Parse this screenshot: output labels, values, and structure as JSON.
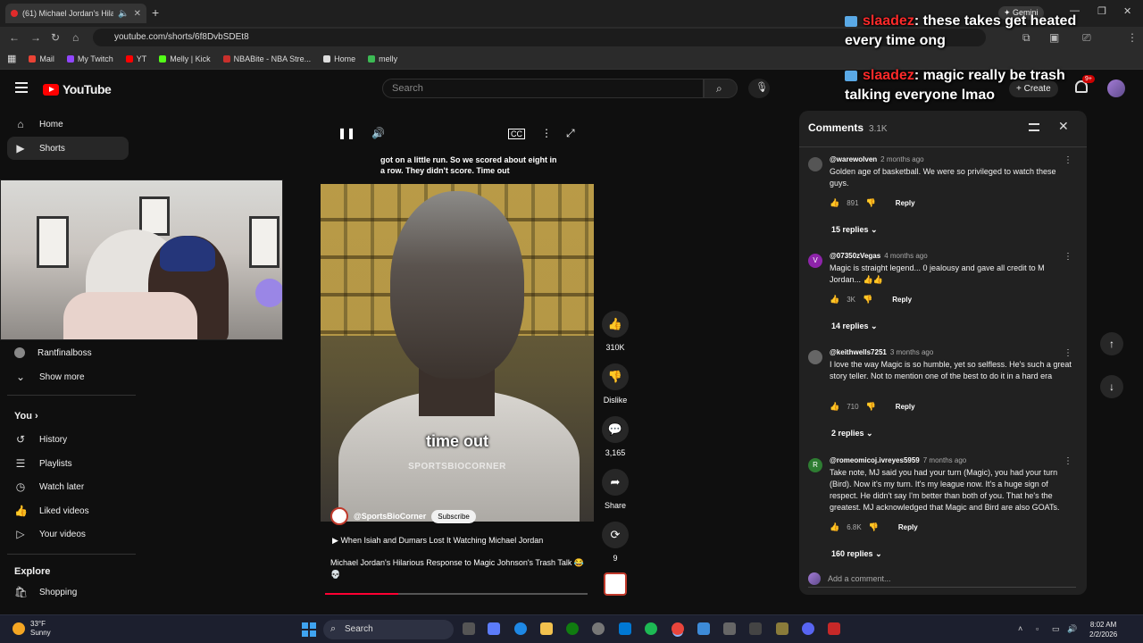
{
  "browser": {
    "tab_title": "(61) Michael Jordan's Hilari",
    "url": "youtube.com/shorts/6f8DvbSDEt8",
    "gemini_label": "Gemini",
    "bookmarks": [
      {
        "label": "Mail",
        "color": "#ea4335"
      },
      {
        "label": "My Twitch",
        "color": "#9146ff"
      },
      {
        "label": "YT",
        "color": "#ff0000"
      },
      {
        "label": "Melly | Kick",
        "color": "#53fc18"
      },
      {
        "label": "NBABite - NBA Stre...",
        "color": "#c9302c"
      },
      {
        "label": "Home",
        "color": "#dddddd"
      },
      {
        "label": "melly",
        "color": "#3cba54"
      }
    ]
  },
  "youtube": {
    "logo_text": "YouTube",
    "search_placeholder": "Search",
    "create_label": "Create",
    "notif_badge": "9+"
  },
  "sidebar": {
    "top": [
      {
        "label": "Home",
        "icon": "home-icon",
        "glyph": "⌂"
      },
      {
        "label": "Shorts",
        "icon": "shorts-icon",
        "glyph": "▶"
      }
    ],
    "subscriptions": [
      {
        "label": "Rantfinalboss",
        "icon": "channel-avatar",
        "glyph": "●"
      },
      {
        "label": "Show more",
        "icon": "chevron-down-icon",
        "glyph": "⌄"
      }
    ],
    "you_heading": "You",
    "you": [
      {
        "label": "History",
        "icon": "history-icon",
        "glyph": "↺"
      },
      {
        "label": "Playlists",
        "icon": "playlists-icon",
        "glyph": "☰"
      },
      {
        "label": "Watch later",
        "icon": "clock-icon",
        "glyph": "◷"
      },
      {
        "label": "Liked videos",
        "icon": "thumbs-up-icon",
        "glyph": "👍"
      },
      {
        "label": "Your videos",
        "icon": "video-icon",
        "glyph": "▷"
      }
    ],
    "explore_heading": "Explore",
    "explore": [
      {
        "label": "Shopping",
        "icon": "shopping-bag-icon",
        "glyph": "🛍"
      }
    ]
  },
  "player": {
    "caption_top": "got on a little run. So we scored about eight in a row. They didn't score. Time out",
    "overlay_text": "time out",
    "watermark": "SPORTSBIOCORNER",
    "channel": "@SportsBioCorner",
    "subscribe_label": "Subscribe",
    "related": "When Isiah and Dumars Lost It Watching Michael Jordan",
    "title": "Michael Jordan's Hilarious Response to Magic Johnson's Trash Talk 😂💀",
    "progress_fraction": 0.28
  },
  "actions": {
    "likes": "310K",
    "dislike_label": "Dislike",
    "comments": "3,165",
    "share_label": "Share",
    "remix_count": "9"
  },
  "comments": {
    "title": "Comments",
    "count": "3.1K",
    "add_placeholder": "Add a comment...",
    "items": [
      {
        "user": "@warewolven",
        "time": "2 months ago",
        "text": "Golden age of basketball. We were so privileged to watch these guys.",
        "likes": "891",
        "replies": "15 replies",
        "avatar_color": "#555555",
        "avatar_letter": ""
      },
      {
        "user": "@07350zVegas",
        "time": "4 months ago",
        "text": "Magic is straight legend... 0 jealousy and gave all credit to M Jordan... 👍👍",
        "likes": "3K",
        "replies": "14 replies",
        "avatar_color": "#8e24aa",
        "avatar_letter": "V"
      },
      {
        "user": "@keithwells7251",
        "time": "3 months ago",
        "text": "I love the way Magic is so humble, yet so selfless. He's such a great story teller. Not to mention one of the best to do it in a hard era",
        "likes": "710",
        "replies": "2 replies",
        "avatar_color": "#666666",
        "avatar_letter": ""
      },
      {
        "user": "@romeomicoj.ivreyes5959",
        "time": "7 months ago",
        "text": "Take note, MJ said you had your turn (Magic), you had your turn (Bird). Now it's my turn. It's my league now. It's a huge sign of respect. He didn't say I'm better than both of you. That he's the greatest. MJ acknowledged that Magic and Bird are also GOATs.",
        "likes": "6.8K",
        "replies": "160 replies",
        "avatar_color": "#2e7d32",
        "avatar_letter": "R"
      }
    ],
    "reply_label": "Reply"
  },
  "chat": [
    {
      "user": "slaadez",
      "text": ": these takes get heated every time ong"
    },
    {
      "user": "slaadez",
      "text": ": magic really be trash talking everyone lmao"
    }
  ],
  "taskbar": {
    "temp": "33°F",
    "condition": "Sunny",
    "search_label": "Search",
    "time": "8:02 AM",
    "date": "2/2/2026"
  }
}
